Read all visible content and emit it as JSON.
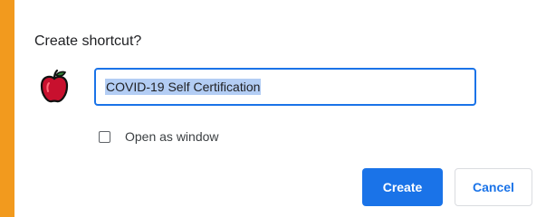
{
  "dialog": {
    "title": "Create shortcut?",
    "icon": "apple-icon",
    "name_field": {
      "value": "COVID-19 Self Certification",
      "selected": true
    },
    "open_as_window": {
      "label": "Open as window",
      "checked": false
    },
    "buttons": {
      "create_label": "Create",
      "cancel_label": "Cancel"
    }
  },
  "colors": {
    "background": "#f29a1e",
    "accent": "#1a73e8",
    "icon_red": "#c8102e",
    "selection": "#b3cdf4"
  }
}
